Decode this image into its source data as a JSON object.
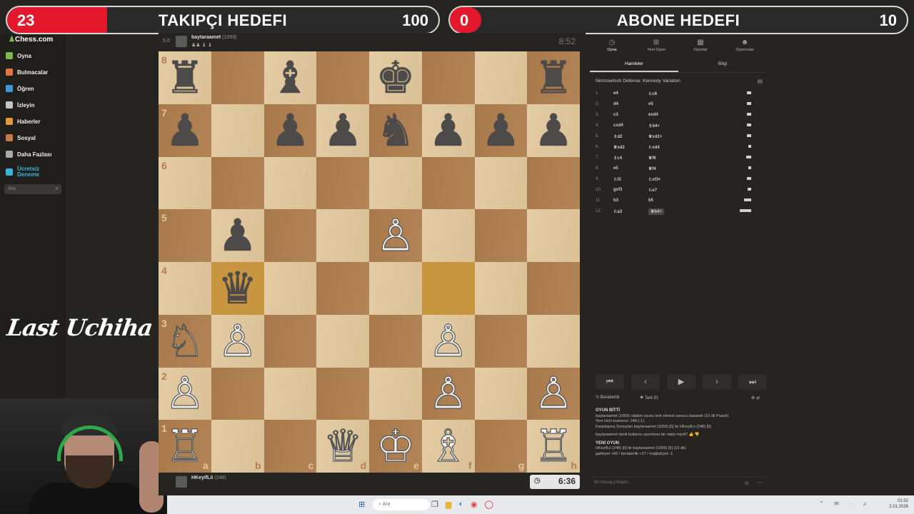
{
  "goals": {
    "followers": {
      "current": "23",
      "title": "TAKIPÇI HEDEFI",
      "target": "100",
      "progress": 0.23
    },
    "subscribers": {
      "current": "0",
      "title": "ABONE HEDEFI",
      "target": "10",
      "progress": 0.0
    }
  },
  "sidebar": {
    "logo": "Chess.com",
    "items": [
      {
        "label": "Oyna",
        "color": "#81b64c"
      },
      {
        "label": "Bulmacalar",
        "color": "#e0763b"
      },
      {
        "label": "Öğren",
        "color": "#3b9ad9"
      },
      {
        "label": "İzleyin",
        "color": "#c6c6c6"
      },
      {
        "label": "Haberler",
        "color": "#e09a3b"
      },
      {
        "label": "Sosyal",
        "color": "#c8764b"
      },
      {
        "label": "Daha Fazlası",
        "color": "#aaaaaa"
      },
      {
        "label": "Ücretsiz Deneme",
        "color": "#3bb4d9"
      }
    ],
    "search_placeholder": "Ara"
  },
  "overlay_name": "Last Uchiha",
  "top_player": {
    "name": "baytaraamet",
    "rating": "(1059)",
    "clock": "8:52",
    "score": "5.0"
  },
  "bottom_player": {
    "name": "HKeyifLii",
    "rating": "(248)",
    "clock": "6:36"
  },
  "board": {
    "ranks": [
      "8",
      "7",
      "6",
      "5",
      "4",
      "3",
      "2",
      "1"
    ],
    "files": [
      "a",
      "b",
      "c",
      "d",
      "e",
      "f",
      "g",
      "h"
    ],
    "position": [
      [
        "br",
        "",
        "bb",
        "",
        "bk",
        "",
        "",
        "br"
      ],
      [
        "bp",
        "",
        "bp",
        "bp",
        "bn",
        "bp",
        "bp",
        "bp"
      ],
      [
        "",
        "",
        "",
        "",
        "",
        "",
        "",
        ""
      ],
      [
        "",
        "bp",
        "",
        "",
        "wp",
        "",
        "",
        ""
      ],
      [
        "",
        "bq",
        "",
        "",
        "",
        "",
        "",
        ""
      ],
      [
        "wn",
        "wp",
        "",
        "",
        "",
        "wp",
        "",
        ""
      ],
      [
        "wp",
        "",
        "",
        "",
        "",
        "wp",
        "",
        "wp"
      ],
      [
        "wr",
        "",
        "",
        "wq",
        "wk",
        "wb",
        "",
        "wr"
      ]
    ],
    "highlights": [
      "b4",
      "f4"
    ]
  },
  "panel": {
    "tabs": [
      "Oyna",
      "Yeni Oyun",
      "Oyunlar",
      "Oyuncular"
    ],
    "subtabs": [
      "Hamleler",
      "Bilgi"
    ],
    "opening": "Nimzowitsch Defense: Kennedy Variation",
    "moves": [
      {
        "n": "1.",
        "w": "e4",
        "b": "♘c6",
        "bar": 6
      },
      {
        "n": "2.",
        "w": "d4",
        "b": "e5",
        "bar": 6
      },
      {
        "n": "3.",
        "w": "c3",
        "b": "exd4",
        "bar": 6
      },
      {
        "n": "4.",
        "w": "cxd4",
        "b": "♗b4+",
        "bar": 6
      },
      {
        "n": "5.",
        "w": "♗d2",
        "b": "♕xd2+",
        "bar": 6
      },
      {
        "n": "6.",
        "w": "♕xd2",
        "b": "♘xd4",
        "bar": 4
      },
      {
        "n": "7.",
        "w": "♗c4",
        "b": "♕f6",
        "bar": 7
      },
      {
        "n": "8.",
        "w": "e5",
        "b": "♕f4",
        "bar": 4
      },
      {
        "n": "9.",
        "w": "♘f3",
        "b": "♘xf3+",
        "bar": 6
      },
      {
        "n": "10.",
        "w": "gxf3",
        "b": "♘e7",
        "bar": 5
      },
      {
        "n": "11.",
        "w": "b3",
        "b": "b5",
        "bar": 10
      },
      {
        "n": "12.",
        "w": "♘a3",
        "b": "♕b4+",
        "bar": 16,
        "cur": true
      }
    ],
    "nav": [
      "⏮",
      "‹",
      "▶",
      "›",
      "⏭"
    ],
    "draw_label": "Beraberlik",
    "resign_label": "Terk Et",
    "chat": {
      "over_title": "OYUN BİTTİ",
      "over_line1": "baytaraamet (1059) rakibin oyunu terk etmesi sonucu kazandı (10 dk Puanlı)",
      "over_line2": "Yeni Hızlı puanınız: 248 (-1).",
      "over_line3": "Karşılaşma Sonuçları baytaraamet (1059) [5] ile HKeyifLii (248) [0]",
      "sport_line": "baytaraamet isimli kullanıcı sportmen bir rakip miydi?",
      "new_title": "YENİ OYUN",
      "new_line1": "HKeyifLii (248) [0] ile baytaraamet (1059) [5] (10 dk)",
      "new_line2": "galibiyet +56 / beraberlik +27 / mağlubiyet -1"
    },
    "message_placeholder": "Bir mesaj yollayın..."
  },
  "taskbar": {
    "search": "Ara",
    "time": "01:52",
    "date": "2.01.2026"
  }
}
